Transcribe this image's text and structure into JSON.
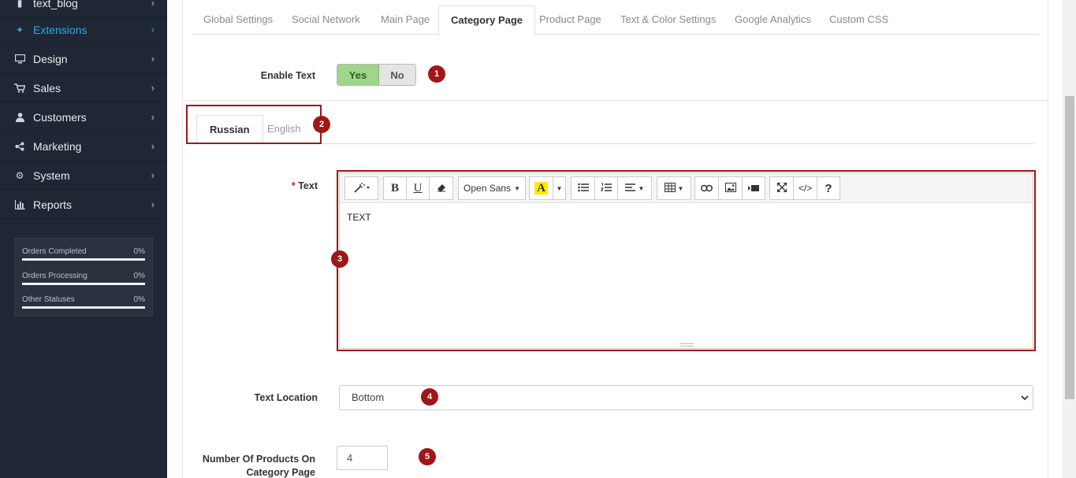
{
  "sidebar": {
    "items": [
      {
        "label": "text_blog",
        "icon": "blog-icon"
      },
      {
        "label": "Extensions",
        "icon": "puzzle-icon",
        "active": true
      },
      {
        "label": "Design",
        "icon": "monitor-icon"
      },
      {
        "label": "Sales",
        "icon": "cart-icon"
      },
      {
        "label": "Customers",
        "icon": "user-icon"
      },
      {
        "label": "Marketing",
        "icon": "share-icon"
      },
      {
        "label": "System",
        "icon": "cog-icon"
      },
      {
        "label": "Reports",
        "icon": "bar-chart-icon"
      }
    ],
    "stats": [
      {
        "label": "Orders Completed",
        "value": "0%"
      },
      {
        "label": "Orders Processing",
        "value": "0%"
      },
      {
        "label": "Other Statuses",
        "value": "0%"
      }
    ],
    "accent_color": "#2ea8e6",
    "background_color": "#1e2733"
  },
  "tabs": [
    "Global Settings",
    "Social Network",
    "Main Page",
    "Category Page",
    "Product Page",
    "Text & Color Settings",
    "Google Analytics",
    "Custom CSS"
  ],
  "active_tab": "Category Page",
  "enable_text": {
    "label": "Enable Text",
    "yes": "Yes",
    "no": "No",
    "selected": "Yes"
  },
  "language_tabs": [
    "Russian",
    "English"
  ],
  "active_language": "Russian",
  "text_field": {
    "required_mark": "*",
    "label": "Text",
    "content": "TEXT",
    "toolbar": {
      "font_name": "Open Sans",
      "bold": "B",
      "underline": "U",
      "color_letter": "A",
      "help": "?",
      "code": "</>"
    }
  },
  "text_location": {
    "label": "Text Location",
    "value": "Bottom"
  },
  "products_count": {
    "label_line1": "Number Of Products On",
    "label_line2": "Category Page",
    "value": "4"
  },
  "badges": [
    "1",
    "2",
    "3",
    "4",
    "5"
  ],
  "highlight_color": "#a11618",
  "toggle_yes_color": "#9fd68a"
}
